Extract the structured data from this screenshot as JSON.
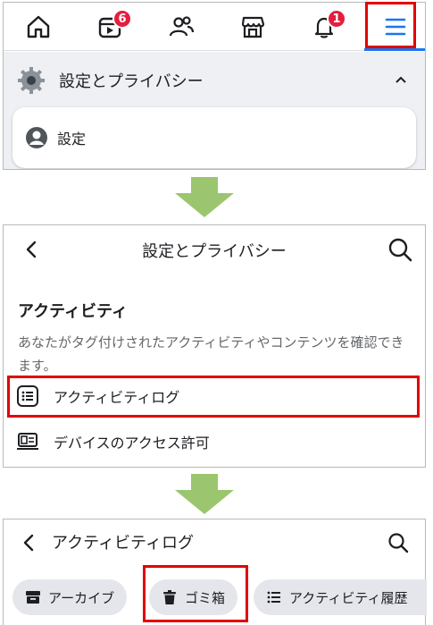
{
  "nav": {
    "items": [
      {
        "icon": "home-icon"
      },
      {
        "icon": "video-icon",
        "badge": "6"
      },
      {
        "icon": "friends-icon"
      },
      {
        "icon": "marketplace-icon"
      },
      {
        "icon": "bell-icon",
        "badge": "1"
      },
      {
        "icon": "menu-icon"
      }
    ]
  },
  "panel1": {
    "section_title": "設定とプライバシー",
    "card_label": "設定"
  },
  "panel2": {
    "title": "設定とプライバシー",
    "section_title": "アクティビティ",
    "description": "あなたがタグ付けされたアクティビティやコンテンツを確認できます。",
    "rows": [
      {
        "label": "アクティビティログ"
      },
      {
        "label": "デバイスのアクセス許可"
      }
    ]
  },
  "panel3": {
    "title": "アクティビティログ",
    "chips": [
      {
        "label": "アーカイブ"
      },
      {
        "label": "ゴミ箱"
      },
      {
        "label": "アクティビティ履歴"
      }
    ]
  },
  "colors": {
    "highlight": "#e30000",
    "accent": "#1877f2",
    "arrow": "#9bc66f",
    "badge": "#e41e3f"
  }
}
